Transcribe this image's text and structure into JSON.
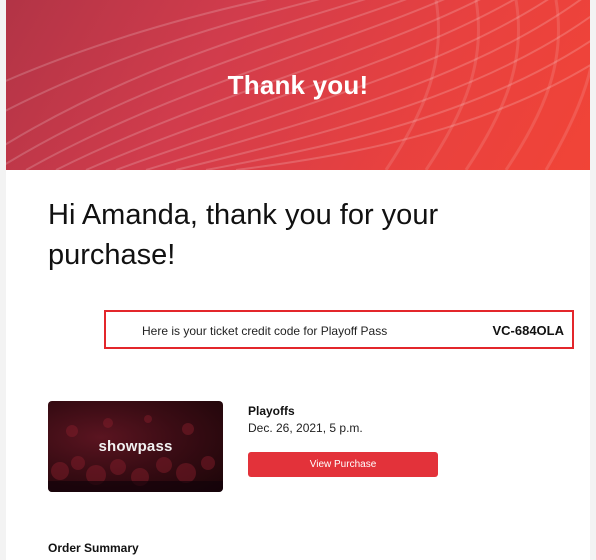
{
  "hero": {
    "title": "Thank you!"
  },
  "greeting": "Hi Amanda, thank you for your purchase!",
  "ticket_credit": {
    "label": "Here is your ticket credit code for Playoff Pass",
    "code": "VC-684OLA"
  },
  "event": {
    "brand": "showpass",
    "name": "Playoffs",
    "date": "Dec. 26, 2021, 5 p.m.",
    "button_label": "View Purchase"
  },
  "order_summary": {
    "heading": "Order Summary"
  },
  "colors": {
    "accent": "#e3323a",
    "highlight_border": "#e3262b"
  }
}
